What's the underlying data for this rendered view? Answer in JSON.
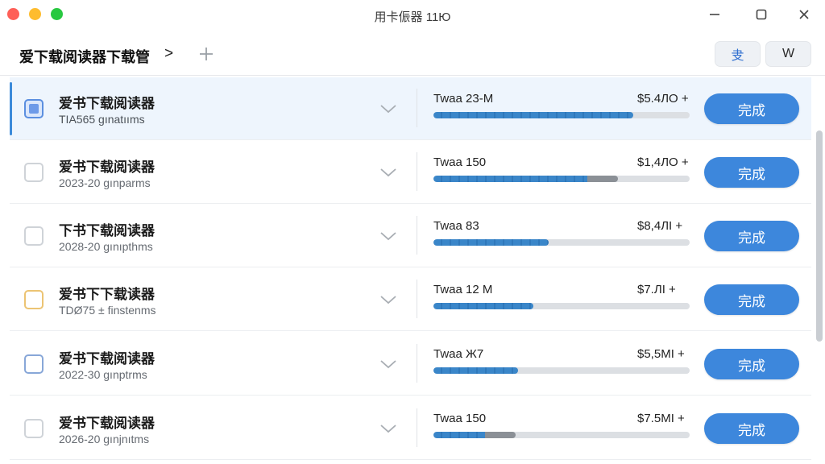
{
  "window": {
    "title": "用卡侲器 11Ю"
  },
  "toolbar": {
    "breadcrumb": "爱下载阅读器下载管",
    "chevron": ">",
    "seg_a": "叏",
    "seg_b": "W"
  },
  "rows": [
    {
      "name": "爱书下载阅读器",
      "meta": "TIA565 gınatııms",
      "size": "Twaa 23-M",
      "price": "$5.4ЛO +",
      "progress": 0.78,
      "grey": 0,
      "action": "完成",
      "selected": true,
      "check": "checked"
    },
    {
      "name": "爱书下载阅读器",
      "meta": "2023-20 gınparms",
      "size": "Twaa 150",
      "price": "$1,4ЛO +",
      "progress": 0.6,
      "grey": 0.12,
      "action": "完成",
      "selected": false,
      "check": "empty"
    },
    {
      "name": "下书下载阅读器",
      "meta": "2028-20 gınıpthms",
      "size": "Twaa 83",
      "price": "$8,4ЛI +",
      "progress": 0.45,
      "grey": 0,
      "action": "完成",
      "selected": false,
      "check": "empty"
    },
    {
      "name": "爱书下下载读器",
      "meta": "TDØ75 ± finstenms",
      "size": "Twaa 12 M",
      "price": "$7.ЛI +",
      "progress": 0.39,
      "grey": 0,
      "action": "完成",
      "selected": false,
      "check": "yellow"
    },
    {
      "name": "爱书下载阅读器",
      "meta": "2022-30 gınptrms",
      "size": "Twaa Ж7",
      "price": "$5,5MI +",
      "progress": 0.33,
      "grey": 0,
      "action": "完成",
      "selected": false,
      "check": "blue"
    },
    {
      "name": "爱书下载阅读器",
      "meta": "2026-20 gınjnıtms",
      "size": "Twaa 150",
      "price": "$7.5MI +",
      "progress": 0.2,
      "grey": 0.12,
      "action": "完成",
      "selected": false,
      "check": "empty"
    }
  ]
}
